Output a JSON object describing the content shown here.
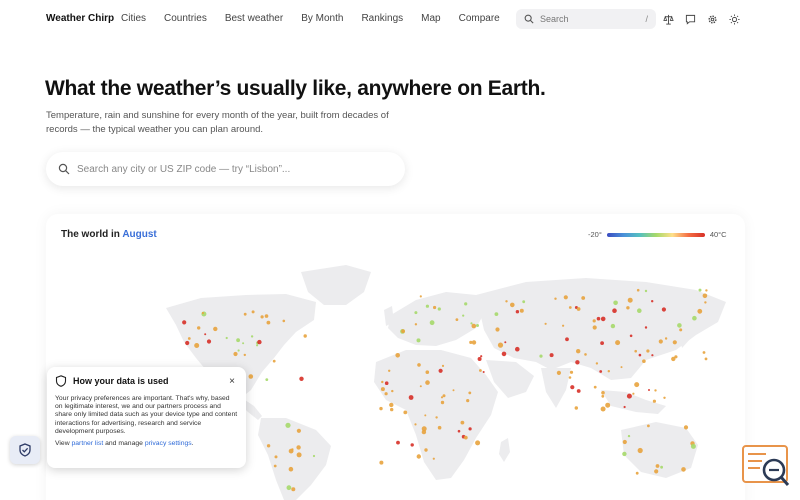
{
  "nav": {
    "brand": "Weather Chirp",
    "links": [
      "Cities",
      "Countries",
      "Best weather",
      "By Month",
      "Rankings",
      "Map",
      "Compare"
    ],
    "search_placeholder": "Search",
    "search_shortcut": "/",
    "icons": [
      "scale-icon",
      "chat-icon",
      "gear-icon",
      "sun-icon"
    ]
  },
  "hero": {
    "title": "What the weather’s usually like, anywhere on Earth.",
    "subtitle": "Temperature, rain and sunshine for every month of the year, built from decades of records — the typical weather you can plan around.",
    "search_placeholder": "Search any city or US ZIP code — try “Lisbon”..."
  },
  "map": {
    "title_prefix": "The world in",
    "month": "August",
    "legend_min": "-20°",
    "legend_max": "40°C",
    "colors": {
      "cold": "#3b4cc0",
      "mild": "#a6d96a",
      "warm": "#e8a33d",
      "hot": "#d73027"
    }
  },
  "privacy": {
    "title": "How your data is used",
    "close": "×",
    "body": "Your privacy preferences are important. That's why, based on legitimate interest, we and our partners process and share only limited data such as your device type and content interactions for advertising, research and service development purposes.",
    "foot_pre": "View ",
    "partner_link": "partner list",
    "foot_mid": " and manage ",
    "settings_link": "privacy settings",
    "foot_post": "."
  }
}
